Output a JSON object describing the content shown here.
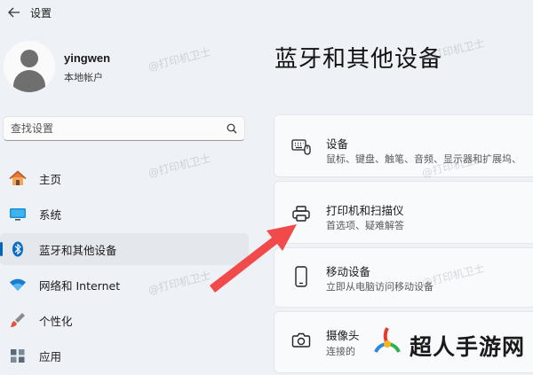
{
  "app": {
    "title": "设置"
  },
  "user": {
    "name": "yingwen",
    "account_type": "本地帐户"
  },
  "search": {
    "placeholder": "查找设置"
  },
  "nav": {
    "items": [
      {
        "label": "主页",
        "icon": "home-icon"
      },
      {
        "label": "系统",
        "icon": "monitor-icon"
      },
      {
        "label": "蓝牙和其他设备",
        "icon": "bluetooth-icon",
        "active": true
      },
      {
        "label": "网络和 Internet",
        "icon": "wifi-icon"
      },
      {
        "label": "个性化",
        "icon": "paintbrush-icon"
      },
      {
        "label": "应用",
        "icon": "apps-icon"
      }
    ]
  },
  "page": {
    "title": "蓝牙和其他设备"
  },
  "cards": [
    {
      "title": "设备",
      "subtitle": "鼠标、键盘、触笔、音频、显示器和扩展坞、",
      "icon": "keyboard-device-icon"
    },
    {
      "title": "打印机和扫描仪",
      "subtitle": "首选项、疑难解答",
      "icon": "printer-icon"
    },
    {
      "title": "移动设备",
      "subtitle": "立即从电脑访问移动设备",
      "icon": "phone-icon"
    },
    {
      "title": "摄像头",
      "subtitle": "连接的",
      "icon": "camera-icon"
    }
  ],
  "watermark": {
    "text": "@打印机卫士"
  },
  "logo": {
    "text": "超人手游网"
  },
  "colors": {
    "accent": "#0067c0",
    "arrow": "#f04a4a",
    "background": "#eef1f5"
  }
}
